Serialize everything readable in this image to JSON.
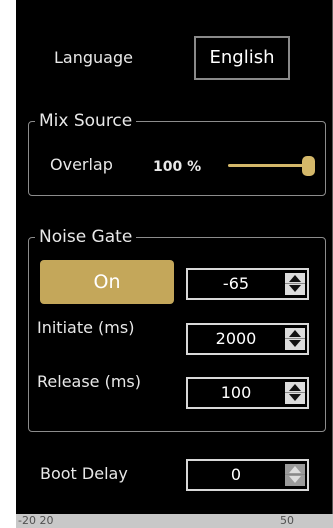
{
  "language": {
    "label": "Language",
    "value": "English"
  },
  "mix_source": {
    "title": "Mix Source",
    "overlap_label": "Overlap",
    "overlap_value": "100 %",
    "overlap_fraction": 1.0,
    "accent_color": "#d4b86a"
  },
  "noise_gate": {
    "title": "Noise Gate",
    "toggle_label": "On",
    "threshold_value": "-65",
    "initiate_label": "Initiate (ms)",
    "initiate_value": "2000",
    "release_label": "Release (ms)",
    "release_value": "100",
    "button_color": "#c4a75a"
  },
  "boot_delay": {
    "label": "Boot Delay",
    "value": "0"
  },
  "background_chart": {
    "left_text": "-20 20",
    "right_text": "50"
  }
}
